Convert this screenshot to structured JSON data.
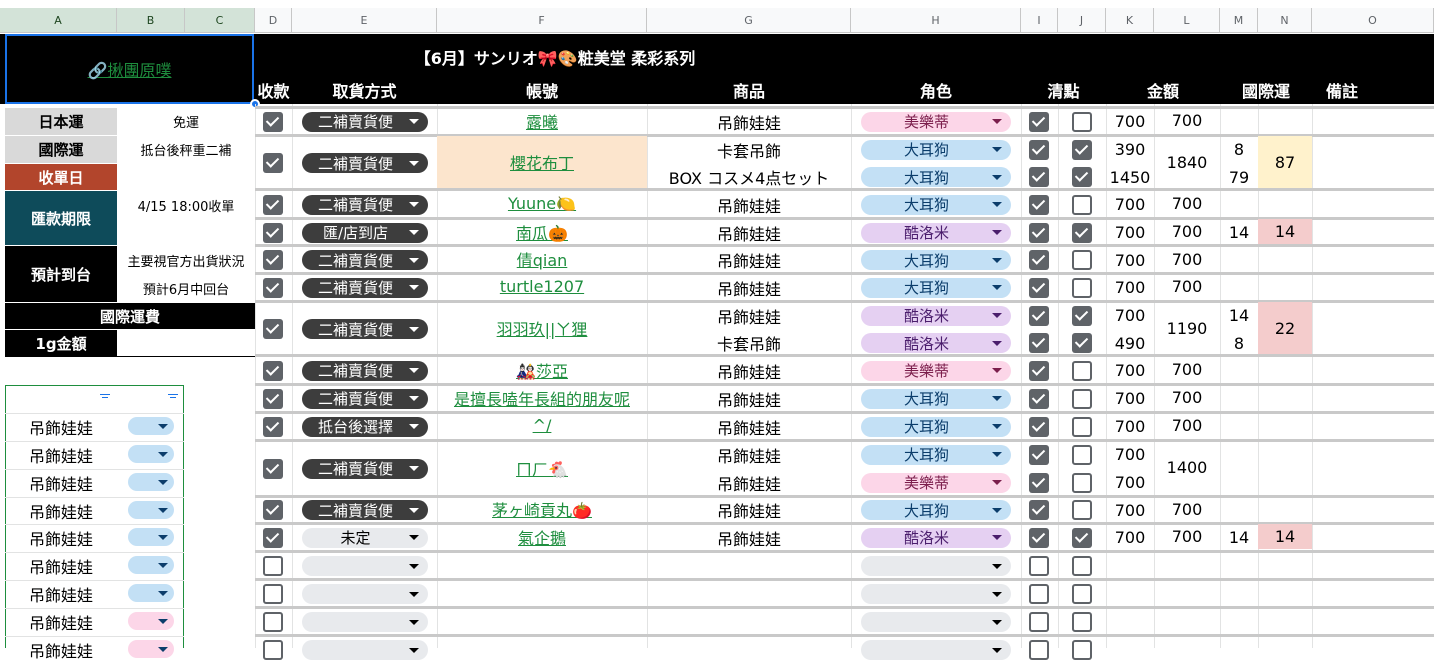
{
  "columns": [
    "A",
    "B",
    "C",
    "D",
    "E",
    "F",
    "G",
    "H",
    "I",
    "J",
    "K",
    "L",
    "M",
    "N",
    "O"
  ],
  "left_panel": {
    "link": "🔗揪團原噗",
    "japan_shipping_label": "日本運",
    "japan_shipping_value": "免運",
    "intl_shipping_label": "國際運",
    "intl_shipping_value": "抵台後秤重二補",
    "close_date_label": "收單日",
    "payment_deadline_label": "匯款期限",
    "deadline_value": "4/15 18:00收單",
    "eta_label": "預計到台",
    "eta_line1": "主要視官方出貨狀況",
    "eta_line2": "預計6月中回台",
    "intl_fee_label": "國際運費",
    "per_gram_label": "1g金額",
    "filter_list": [
      "吊飾娃娃",
      "吊飾娃娃",
      "吊飾娃娃",
      "吊飾娃娃",
      "吊飾娃娃",
      "吊飾娃娃",
      "吊飾娃娃",
      "吊飾娃娃",
      "吊飾娃娃"
    ]
  },
  "title": "【6月】サンリオ🎀🎨粧美堂 柔彩系列",
  "headers": {
    "paid": "收款",
    "pickup": "取貨方式",
    "account": "帳號",
    "product": "商品",
    "character": "角色",
    "checked": "清點",
    "amount": "金額",
    "intl_shipping": "國際運",
    "notes": "備註"
  },
  "rows": [
    {
      "pickup": "二補賣貨便",
      "account": "露曦",
      "product": "吊飾娃娃",
      "character": "美樂蒂",
      "color": "pink",
      "j": false,
      "k": "700",
      "l": "700",
      "m": "",
      "n": ""
    },
    {
      "pickup": "二補賣貨便",
      "account": "櫻花布丁",
      "product": "卡套吊飾",
      "character": "大耳狗",
      "color": "blue",
      "j": true,
      "k": "390",
      "l": "1840",
      "m": "8",
      "n": "87"
    },
    {
      "product": "BOX コスメ4点セット",
      "character": "大耳狗",
      "color": "blue",
      "j": true,
      "k": "1450",
      "m": "79"
    },
    {
      "pickup": "二補賣貨便",
      "account": "Yuune🍋",
      "product": "吊飾娃娃",
      "character": "大耳狗",
      "color": "blue",
      "j": false,
      "k": "700",
      "l": "700",
      "m": "",
      "n": ""
    },
    {
      "pickup": "匯/店到店",
      "account": "南瓜🎃",
      "product": "吊飾娃娃",
      "character": "酷洛米",
      "color": "purple",
      "j": true,
      "k": "700",
      "l": "700",
      "m": "14",
      "n": "14"
    },
    {
      "pickup": "二補賣貨便",
      "account": "倩qian",
      "product": "吊飾娃娃",
      "character": "大耳狗",
      "color": "blue",
      "j": false,
      "k": "700",
      "l": "700",
      "m": "",
      "n": ""
    },
    {
      "pickup": "二補賣貨便",
      "account": "turtle1207",
      "product": "吊飾娃娃",
      "character": "大耳狗",
      "color": "blue",
      "j": false,
      "k": "700",
      "l": "700",
      "m": "",
      "n": ""
    },
    {
      "pickup": "二補賣貨便",
      "account": "羽羽玖||ㄚ狸",
      "product": "吊飾娃娃",
      "character": "酷洛米",
      "color": "purple",
      "j": true,
      "k": "700",
      "l": "1190",
      "m": "14",
      "n": "22"
    },
    {
      "product": "卡套吊飾",
      "character": "酷洛米",
      "color": "purple",
      "j": true,
      "k": "490",
      "m": "8"
    },
    {
      "pickup": "二補賣貨便",
      "account": "🎎莎亞",
      "product": "吊飾娃娃",
      "character": "美樂蒂",
      "color": "pink",
      "j": false,
      "k": "700",
      "l": "700",
      "m": "",
      "n": ""
    },
    {
      "pickup": "二補賣貨便",
      "account": "是擅長嗑年長組的朋友呢",
      "product": "吊飾娃娃",
      "character": "大耳狗",
      "color": "blue",
      "j": false,
      "k": "700",
      "l": "700",
      "m": "",
      "n": ""
    },
    {
      "pickup": "抵台後選擇",
      "account": "^/",
      "product": "吊飾娃娃",
      "character": "大耳狗",
      "color": "blue",
      "j": false,
      "k": "700",
      "l": "700",
      "m": "",
      "n": ""
    },
    {
      "pickup": "二補賣貨便",
      "account": "ㄇㄏ🐔",
      "product": "吊飾娃娃",
      "character": "大耳狗",
      "color": "blue",
      "j": false,
      "k": "700",
      "l": "1400",
      "m": "",
      "n": ""
    },
    {
      "product": "吊飾娃娃",
      "character": "美樂蒂",
      "color": "pink",
      "j": false,
      "k": "700"
    },
    {
      "pickup": "二補賣貨便",
      "account": "茅ヶ崎貢丸🍅",
      "product": "吊飾娃娃",
      "character": "大耳狗",
      "color": "blue",
      "j": false,
      "k": "700",
      "l": "700",
      "m": "",
      "n": ""
    },
    {
      "pickup": "未定",
      "account": "氣企鵝",
      "product": "吊飾娃娃",
      "character": "酷洛米",
      "color": "purple",
      "j": true,
      "k": "700",
      "l": "700",
      "m": "14",
      "n": "14"
    }
  ]
}
